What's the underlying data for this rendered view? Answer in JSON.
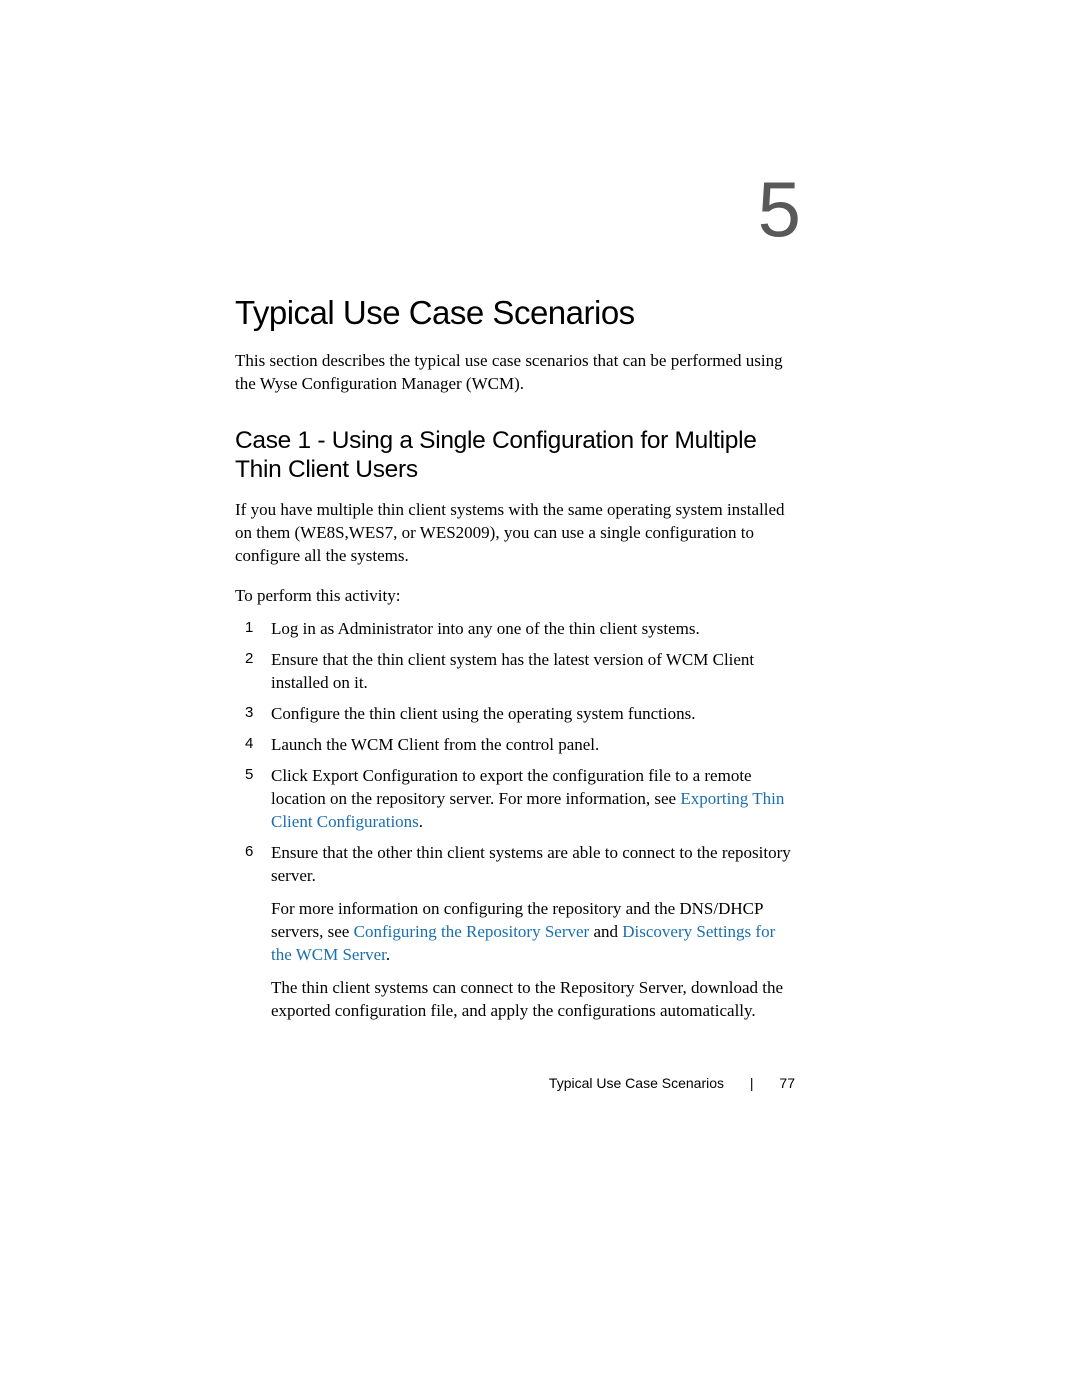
{
  "chapter": {
    "number": "5",
    "title": "Typical Use Case Scenarios",
    "intro": "This section describes the typical use case scenarios that can be performed using the Wyse Configuration Manager (WCM)."
  },
  "section": {
    "title": "Case 1 - Using a Single Configuration for Multiple Thin Client Users",
    "para": "If you have multiple thin client systems with the same operating system installed on them (WE8S,WES7, or WES2009), you can use a single configuration to configure all the systems.",
    "lead": "To perform this activity:",
    "steps": [
      {
        "text": "Log in as Administrator into any one of the thin client systems."
      },
      {
        "text": "Ensure that the thin client system has the latest version of WCM Client installed on it."
      },
      {
        "text": "Configure the thin client using the operating system functions."
      },
      {
        "text": "Launch the WCM Client from the control panel."
      },
      {
        "text_a": "Click Export Configuration to export the configuration file to a remote location on the repository server. For more information, see ",
        "link1": "Exporting Thin Client Configurations",
        "text_b": "."
      },
      {
        "text": "Ensure that the other thin client systems are able to connect to the repository server.",
        "sub1_a": "For more information on configuring the repository and the DNS/DHCP servers, see ",
        "sub1_link1": "Configuring the Repository Server",
        "sub1_mid": " and ",
        "sub1_link2": "Discovery Settings for the WCM Server",
        "sub1_b": ".",
        "sub2": "The thin client systems can connect to the Repository Server, download the exported configuration file, and apply the configurations automatically."
      }
    ]
  },
  "footer": {
    "title": "Typical Use Case Scenarios",
    "sep": "|",
    "page": "77"
  }
}
